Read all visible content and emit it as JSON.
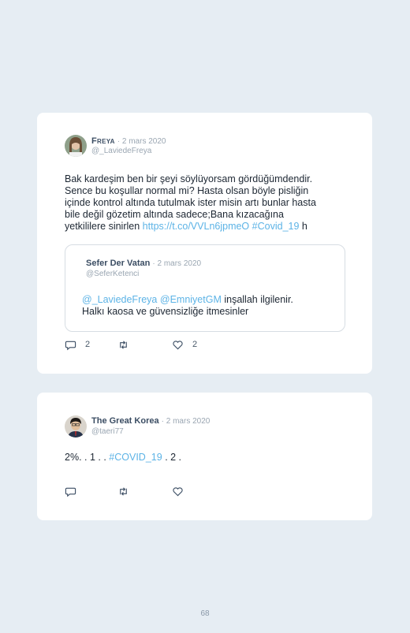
{
  "tweets": [
    {
      "author": "Freya",
      "date": "· 2 mars 2020",
      "handle": "@_LaviedeFreya",
      "text_parts": [
        "Bak kardeşim ben bir şeyi söylüyorsam gördüğümdendir.",
        "Sence bu koşullar normal mi? Hasta olsan böyle pisliğin",
        "içinde kontrol altında tutulmak ister misin artı bunlar hasta",
        "bile değil gözetim altında sadece;Bana kızacağına",
        "yetkililere sinirlen"
      ],
      "link": "https://t.co/VVLn6jpmeO",
      "hashtag": "#Covid_19",
      "trailing": "h",
      "quoted": {
        "author": "Sefer Der Vatan",
        "date": "· 2 mars 2020",
        "handle": "@SeferKetenci",
        "mention1": "@_LaviedeFreya",
        "mention2": "@EmniyetGM",
        "text_line1": "inşallah ilgilenir.",
        "text_line2": "Halkı kaosa ve güvensizliğe itmesinler"
      },
      "actions": {
        "replies": "2",
        "retweets": "",
        "likes": "2"
      }
    },
    {
      "author": "The Great Korea",
      "date": "· 2 mars 2020",
      "handle": "@taeri77",
      "text_before": "2%. . 1 . .",
      "hashtag": "#COVID_19",
      "text_after": ". 2 .",
      "actions": {
        "replies": "",
        "retweets": "",
        "likes": ""
      }
    }
  ],
  "page_number": "68",
  "icons": {
    "reply": "reply-icon",
    "retweet": "retweet-icon",
    "like": "heart-icon"
  },
  "colors": {
    "background": "#e6edf3",
    "card": "#ffffff",
    "link": "#5cb3e6"
  }
}
